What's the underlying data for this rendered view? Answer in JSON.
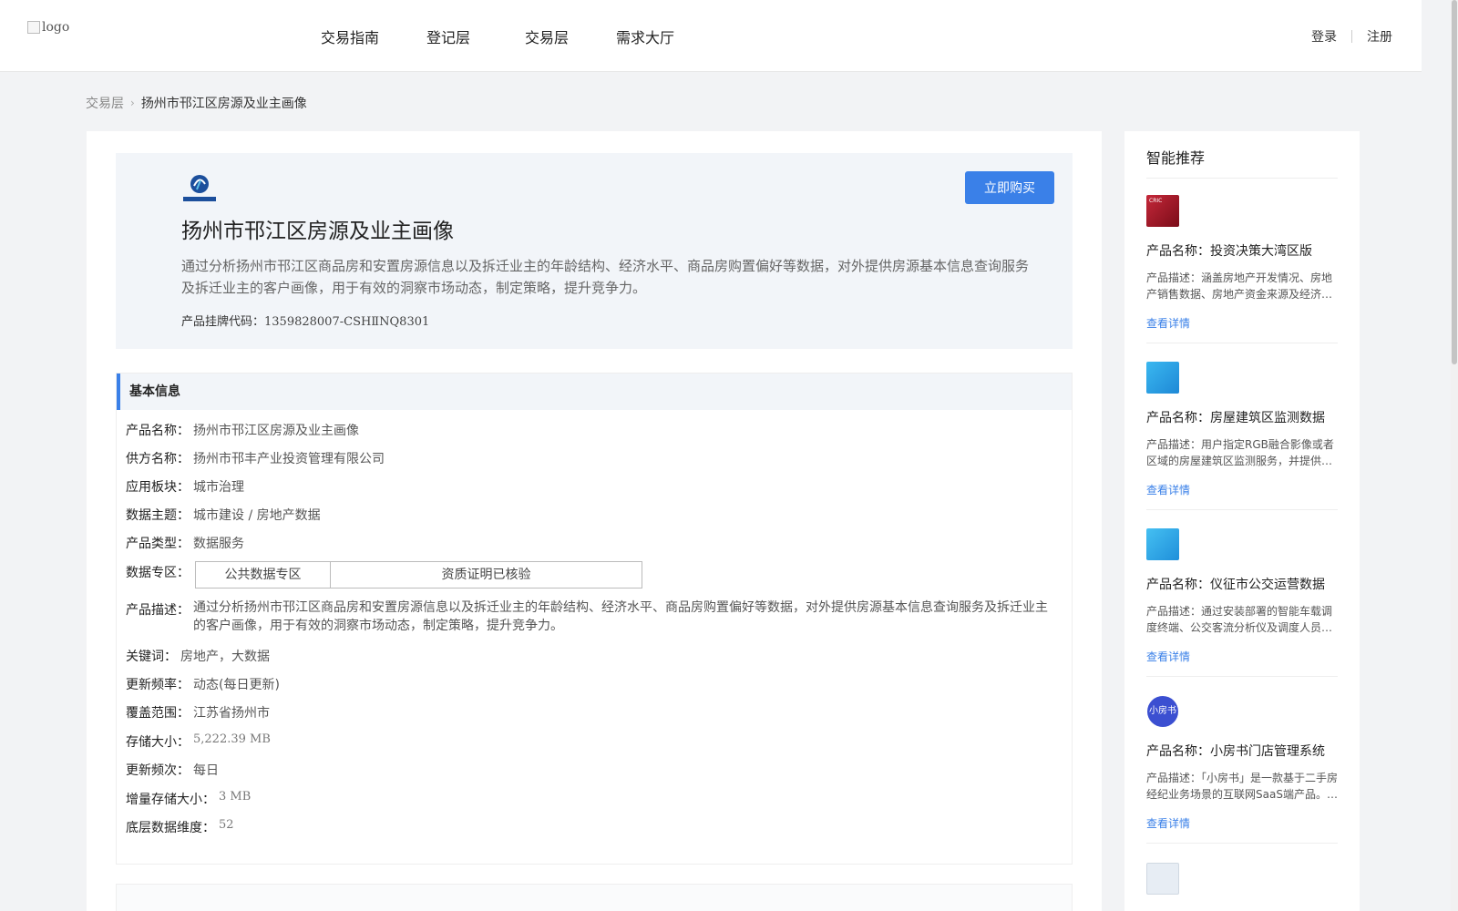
{
  "header": {
    "logo_alt": "logo",
    "nav": [
      {
        "label": "交易指南"
      },
      {
        "label": "登记层"
      },
      {
        "label": "交易层"
      },
      {
        "label": "需求大厅"
      }
    ],
    "login": "登录",
    "register": "注册"
  },
  "breadcrumb": {
    "parent": "交易层",
    "current": "扬州市邗江区房源及业主画像"
  },
  "product": {
    "title": "扬州市邗江区房源及业主画像",
    "description": "通过分析扬州市邗江区商品房和安置房源信息以及拆迁业主的年龄结构、经济水平、商品房购置偏好等数据，对外提供房源基本信息查询服务及拆迁业主的客户画像，用于有效的洞察市场动态，制定策略，提升竞争力。",
    "code_label": "产品挂牌代码：",
    "code_value": "1359828007-CSHⅡNQ8301",
    "buy_label": "立即购买"
  },
  "basic_info": {
    "title": "基本信息",
    "rows": [
      {
        "label": "产品名称：",
        "value": "扬州市邗江区房源及业主画像"
      },
      {
        "label": "供方名称：",
        "value": "扬州市邗丰产业投资管理有限公司"
      },
      {
        "label": "应用板块：",
        "value": "城市治理"
      },
      {
        "label": "数据主题：",
        "value": "城市建设 / 房地产数据"
      },
      {
        "label": "产品类型：",
        "value": "数据服务"
      }
    ],
    "zone_label": "数据专区：",
    "zones": [
      "公共数据专区",
      "资质证明已核验"
    ],
    "desc_label": "产品描述：",
    "desc_value": "通过分析扬州市邗江区商品房和安置房源信息以及拆迁业主的年龄结构、经济水平、商品房购置偏好等数据，对外提供房源基本信息查询服务及拆迁业主的客户画像，用于有效的洞察市场动态，制定策略，提升竞争力。",
    "rows2": [
      {
        "label": "关键词：",
        "value": "房地产，大数据"
      },
      {
        "label": "更新频率：",
        "value": "动态(每日更新)"
      },
      {
        "label": "覆盖范围：",
        "value": "江苏省扬州市"
      },
      {
        "label": "存储大小：",
        "value": "5,222.39 MB"
      },
      {
        "label": "更新频次：",
        "value": "每日"
      },
      {
        "label": "增量存储大小：",
        "value": "3 MB"
      },
      {
        "label": "底层数据维度：",
        "value": "52"
      }
    ]
  },
  "sidebar": {
    "title": "智能推荐",
    "more_label": "查看详情",
    "items": [
      {
        "name": "产品名称：投资决策大湾区版",
        "desc": "产品描述：涵盖房地产开发情况、房地产销售数据、房地产资金来源及经济指标等数据",
        "thumb_color": "#b0182b",
        "thumb_text": "CRIC"
      },
      {
        "name": "产品名称：房屋建筑区监测数据",
        "desc": "产品描述：用户指定RGB融合影像或者区域的房屋建筑区监测服务，并提供其相关数据",
        "thumb_color": "#2aa3e6",
        "thumb_text": ""
      },
      {
        "name": "产品名称：仪征市公交运营数据",
        "desc": "产品描述：通过安装部署的智能车载调度终端、公交客流分析仪及调度人员数据",
        "thumb_color": "#2ba8e8",
        "thumb_text": ""
      },
      {
        "name": "产品名称：小房书门店管理系统",
        "desc": "产品描述：「小房书」是一款基于二手房经纪业务场景的互联网SaaS端产品。它提供门店管理",
        "thumb_color": "#3b4fd1",
        "thumb_text": "小房书"
      },
      {
        "name": "",
        "desc": "",
        "thumb_color": "#dfe6ef",
        "thumb_text": ""
      }
    ]
  },
  "colors": {
    "accent": "#3a80e8",
    "page_bg": "#f2f3f5",
    "hero_bg": "#f2f5f9"
  }
}
